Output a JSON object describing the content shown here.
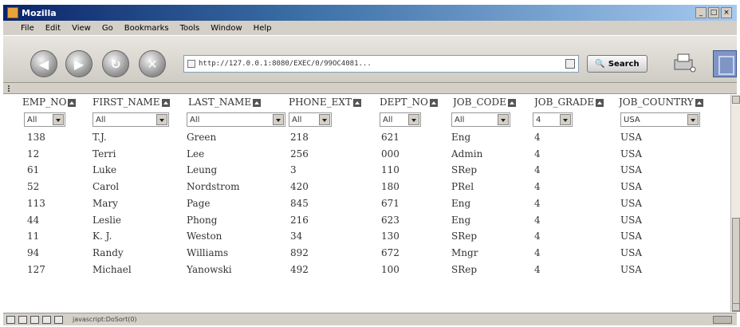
{
  "window": {
    "title": "Mozilla",
    "controls": [
      "_",
      "□",
      "×"
    ]
  },
  "menu": [
    "File",
    "Edit",
    "View",
    "Go",
    "Bookmarks",
    "Tools",
    "Window",
    "Help"
  ],
  "nav": {
    "url": "http://127.0.0.1:8080/EXEC/0/99OC4081...",
    "search_label": "Search"
  },
  "table": {
    "columns": [
      "EMP_NO",
      "FIRST_NAME",
      "LAST_NAME",
      "PHONE_EXT",
      "DEPT_NO",
      "JOB_CODE",
      "JOB_GRADE",
      "JOB_COUNTRY"
    ],
    "filters": [
      "All",
      "All",
      "All",
      "All",
      "All",
      "All",
      "4",
      "USA"
    ],
    "rows": [
      [
        "138",
        "T.J.",
        "Green",
        "218",
        "621",
        "Eng",
        "4",
        "USA"
      ],
      [
        "12",
        "Terri",
        "Lee",
        "256",
        "000",
        "Admin",
        "4",
        "USA"
      ],
      [
        "61",
        "Luke",
        "Leung",
        "3",
        "110",
        "SRep",
        "4",
        "USA"
      ],
      [
        "52",
        "Carol",
        "Nordstrom",
        "420",
        "180",
        "PRel",
        "4",
        "USA"
      ],
      [
        "113",
        "Mary",
        "Page",
        "845",
        "671",
        "Eng",
        "4",
        "USA"
      ],
      [
        "44",
        "Leslie",
        "Phong",
        "216",
        "623",
        "Eng",
        "4",
        "USA"
      ],
      [
        "11",
        "K. J.",
        "Weston",
        "34",
        "130",
        "SRep",
        "4",
        "USA"
      ],
      [
        "94",
        "Randy",
        "Williams",
        "892",
        "672",
        "Mngr",
        "4",
        "USA"
      ],
      [
        "127",
        "Michael",
        "Yanowski",
        "492",
        "100",
        "SRep",
        "4",
        "USA"
      ]
    ]
  },
  "status": {
    "text": "javascript:DoSort(0)"
  }
}
